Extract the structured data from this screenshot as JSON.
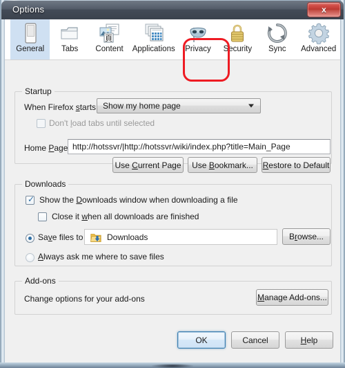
{
  "window": {
    "title": "Options",
    "close_label": "x"
  },
  "tabs": [
    {
      "label": "General",
      "icon": "general-icon",
      "selected": true
    },
    {
      "label": "Tabs",
      "icon": "tabs-icon",
      "selected": false
    },
    {
      "label": "Content",
      "icon": "content-icon",
      "selected": false
    },
    {
      "label": "Applications",
      "icon": "applications-icon",
      "selected": false
    },
    {
      "label": "Privacy",
      "icon": "privacy-mask-icon",
      "selected": false,
      "annotated": true
    },
    {
      "label": "Security",
      "icon": "padlock-icon",
      "selected": false
    },
    {
      "label": "Sync",
      "icon": "sync-icon",
      "selected": false
    },
    {
      "label": "Advanced",
      "icon": "gear-icon",
      "selected": false
    }
  ],
  "annotation": {
    "color": "#ee1b23",
    "target": "Privacy"
  },
  "startup": {
    "legend": "Startup",
    "when_firefox_starts_label": "When Firefox starts:",
    "when_firefox_starts_value": "Show my home page",
    "dont_load_tabs_label": "Don't load tabs until selected",
    "dont_load_tabs_checked": false,
    "dont_load_tabs_disabled": true,
    "home_page_label": "Home Page:",
    "home_page_value": "http://hotssvr/|http://hotssvr/wiki/index.php?title=Main_Page",
    "use_current_page": "Use Current Page",
    "use_bookmark": "Use Bookmark...",
    "restore_to_default": "Restore to Default"
  },
  "downloads": {
    "legend": "Downloads",
    "show_downloads_window_label": "Show the Downloads window when downloading a file",
    "show_downloads_window_checked": true,
    "close_when_finished_label": "Close it when all downloads are finished",
    "close_when_finished_checked": false,
    "save_files_to_label": "Save files to",
    "save_files_to_selected": true,
    "save_files_to_path": "Downloads",
    "folder_icon": "download-folder-icon",
    "browse_label": "Browse...",
    "always_ask_label": "Always ask me where to save files",
    "always_ask_selected": false
  },
  "addons": {
    "legend": "Add-ons",
    "description": "Change options for your add-ons",
    "manage_label": "Manage Add-ons..."
  },
  "footer": {
    "ok": "OK",
    "cancel": "Cancel",
    "help": "Help"
  },
  "colors": {
    "accent": "#cfe0f2",
    "annotation": "#ee1b23",
    "titlebar": "#434b57",
    "panel": "#f0f0f0"
  }
}
